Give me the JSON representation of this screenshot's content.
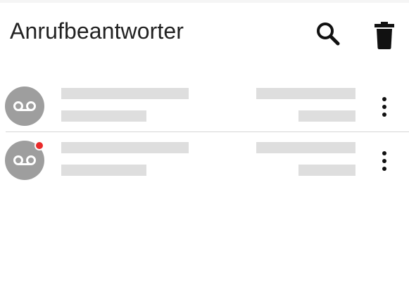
{
  "header": {
    "title": "Anrufbeantworter",
    "icons": [
      "search-icon",
      "trash-icon"
    ]
  },
  "messages": [
    {
      "icon": "voicemail-icon",
      "unread": false,
      "menu_icon": "more-vert-icon"
    },
    {
      "icon": "voicemail-icon",
      "unread": true,
      "menu_icon": "more-vert-icon"
    }
  ],
  "colors": {
    "avatar": "#9e9e9e",
    "unread": "#ea2a2a",
    "placeholder": "#dedede",
    "text": "#222222"
  }
}
